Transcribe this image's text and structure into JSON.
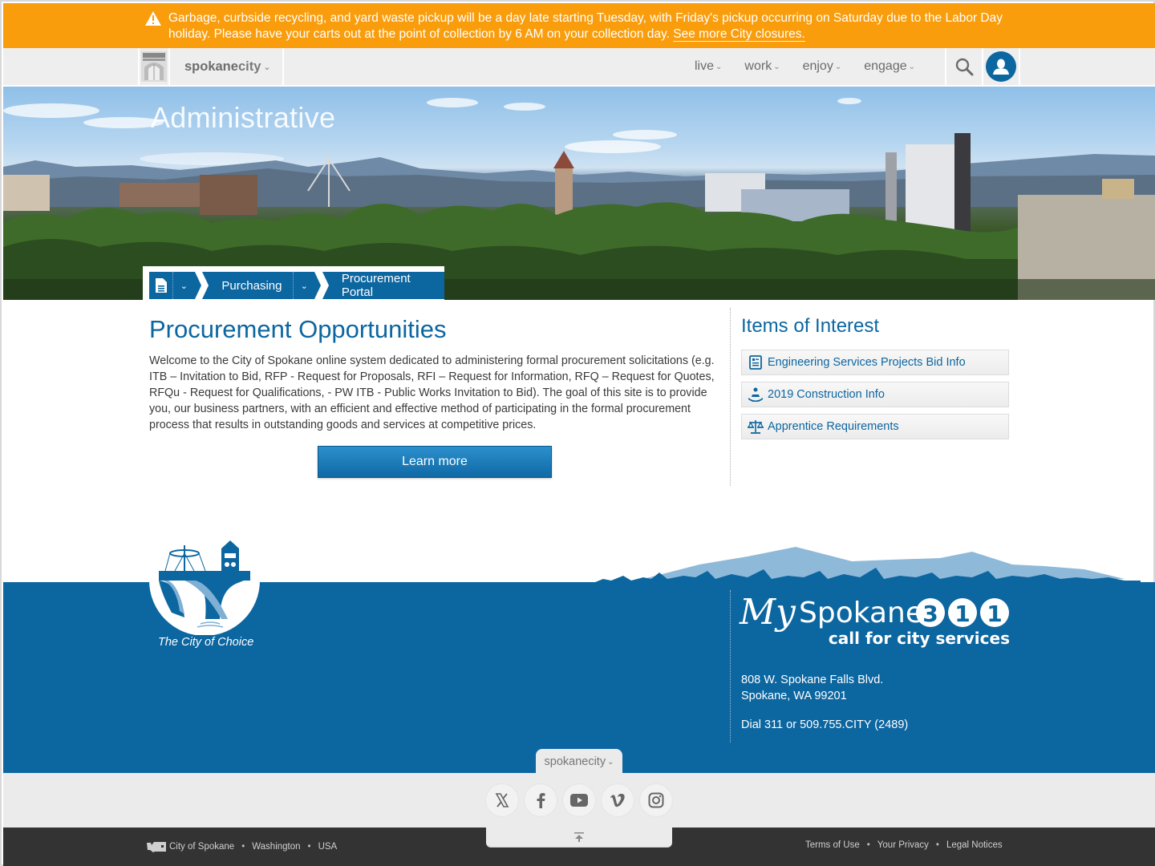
{
  "alert": {
    "icon": "warning-triangle-icon",
    "message": "Garbage, curbside recycling, and yard waste pickup will be a day late starting Tuesday, with Friday's pickup occurring on Saturday due to the Labor Day holiday. Please have your carts out at the point of collection by 6 AM on your collection day.",
    "link_label": "See more City closures."
  },
  "header": {
    "brand_bold": "spokane",
    "brand_light": "city",
    "menu": [
      {
        "label": "live"
      },
      {
        "label": "work"
      },
      {
        "label": "enjoy"
      },
      {
        "label": "engage"
      }
    ],
    "search_icon": "search-icon",
    "account_icon": "user-icon"
  },
  "hero": {
    "title": "Administrative"
  },
  "breadcrumb": {
    "items": [
      {
        "label": "Purchasing"
      },
      {
        "label": "Procurement Portal"
      }
    ]
  },
  "main": {
    "title": "Procurement Opportunities",
    "intro": "Welcome to the City of Spokane online system dedicated to administering formal procurement solicitations (e.g. ITB – Invitation to Bid, RFP - Request for Proposals, RFI – Request for Information, RFQ – Request for Quotes, RFQu - Request for Qualifications, - PW ITB - Public Works Invitation to Bid). The goal of this site is to provide you, our business partners, with an efficient and effective method of participating in the formal procurement process that results in outstanding goods and services at competitive prices.",
    "learn_more_label": "Learn more"
  },
  "sidebar": {
    "title": "Items of Interest",
    "items": [
      {
        "label": "Engineering Services Projects Bid Info",
        "icon": "document-list-icon"
      },
      {
        "label": "2019 Construction Info",
        "icon": "construction-cone-icon"
      },
      {
        "label": "Apprentice Requirements",
        "icon": "balance-scale-icon"
      }
    ]
  },
  "footer": {
    "tagline": "The City of Choice",
    "my311": {
      "script": "My",
      "name": "Spokane",
      "digits": [
        "3",
        "1",
        "1"
      ],
      "sub": "call for city services"
    },
    "address_line1": "808 W. Spokane Falls Blvd.",
    "address_line2": "Spokane, WA 99201",
    "dial": "Dial 311 or 509.755.CITY (2489)",
    "tab_label": "spokanecity",
    "socials": [
      {
        "name": "x",
        "icon": "x-twitter-icon"
      },
      {
        "name": "facebook",
        "icon": "facebook-icon"
      },
      {
        "name": "youtube",
        "icon": "youtube-icon"
      },
      {
        "name": "vimeo",
        "icon": "vimeo-icon"
      },
      {
        "name": "instagram",
        "icon": "instagram-icon"
      }
    ],
    "legal_left": [
      "City of Spokane",
      "Washington",
      "USA"
    ],
    "legal_right": [
      "Terms of Use",
      "Your Privacy",
      "Legal Notices"
    ]
  },
  "colors": {
    "alert": "#f99d0c",
    "brand_blue": "#0c66a0",
    "nav_bg": "#eeeeee",
    "footer_dark": "#333333"
  }
}
